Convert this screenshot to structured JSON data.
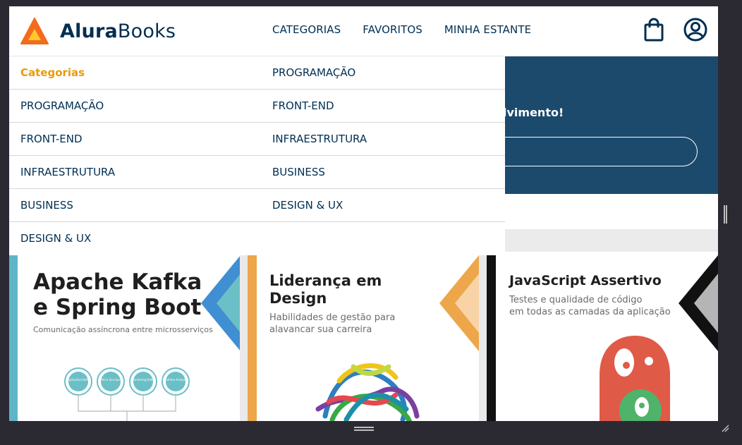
{
  "header": {
    "logo_bold": "Alura",
    "logo_light": "Books",
    "nav": [
      "CATEGORIAS",
      "FAVORITOS",
      "MINHA ESTANTE"
    ],
    "icons": [
      "shopping-bag-icon",
      "user-profile-icon"
    ]
  },
  "hero": {
    "text": "lvimento!"
  },
  "dropdown": {
    "heading": "Categorias",
    "left_items": [
      "PROGRAMAÇÃO",
      "FRONT-END",
      "INFRAESTRUTURA",
      "BUSINESS",
      "DESIGN & UX"
    ],
    "right_items": [
      "PROGRAMAÇÃO",
      "FRONT-END",
      "INFRAESTRUTURA",
      "BUSINESS",
      "DESIGN & UX"
    ]
  },
  "books": [
    {
      "title_line1": "Apache Kafka",
      "title_line2": "e Spring Boot",
      "subtitle": "Comunicação assíncrona entre microsserviços",
      "accent": "#3f8fd2",
      "stripe": "#5db6c7",
      "diagram_nodes": [
        "Application Kafka",
        "Micro Serviços",
        "Monitoring Kafka",
        "Realtime Analytics"
      ]
    },
    {
      "title_line1": "Liderança em",
      "title_line2": "Design",
      "subtitle_line1": "Habilidades de gestão para",
      "subtitle_line2": "alavancar sua carreira",
      "accent": "#eda64a",
      "stripe": "#eda64a"
    },
    {
      "title_line1": "JavaScript Assertivo",
      "subtitle_line1": "Testes e qualidade de código",
      "subtitle_line2": "em todas as camadas da aplicação",
      "accent": "#111111",
      "stripe": "#111111"
    }
  ],
  "colors": {
    "brand_orange": "#eb9b00",
    "brand_navy": "#002f52",
    "hero_blue": "#1b4a6d"
  }
}
